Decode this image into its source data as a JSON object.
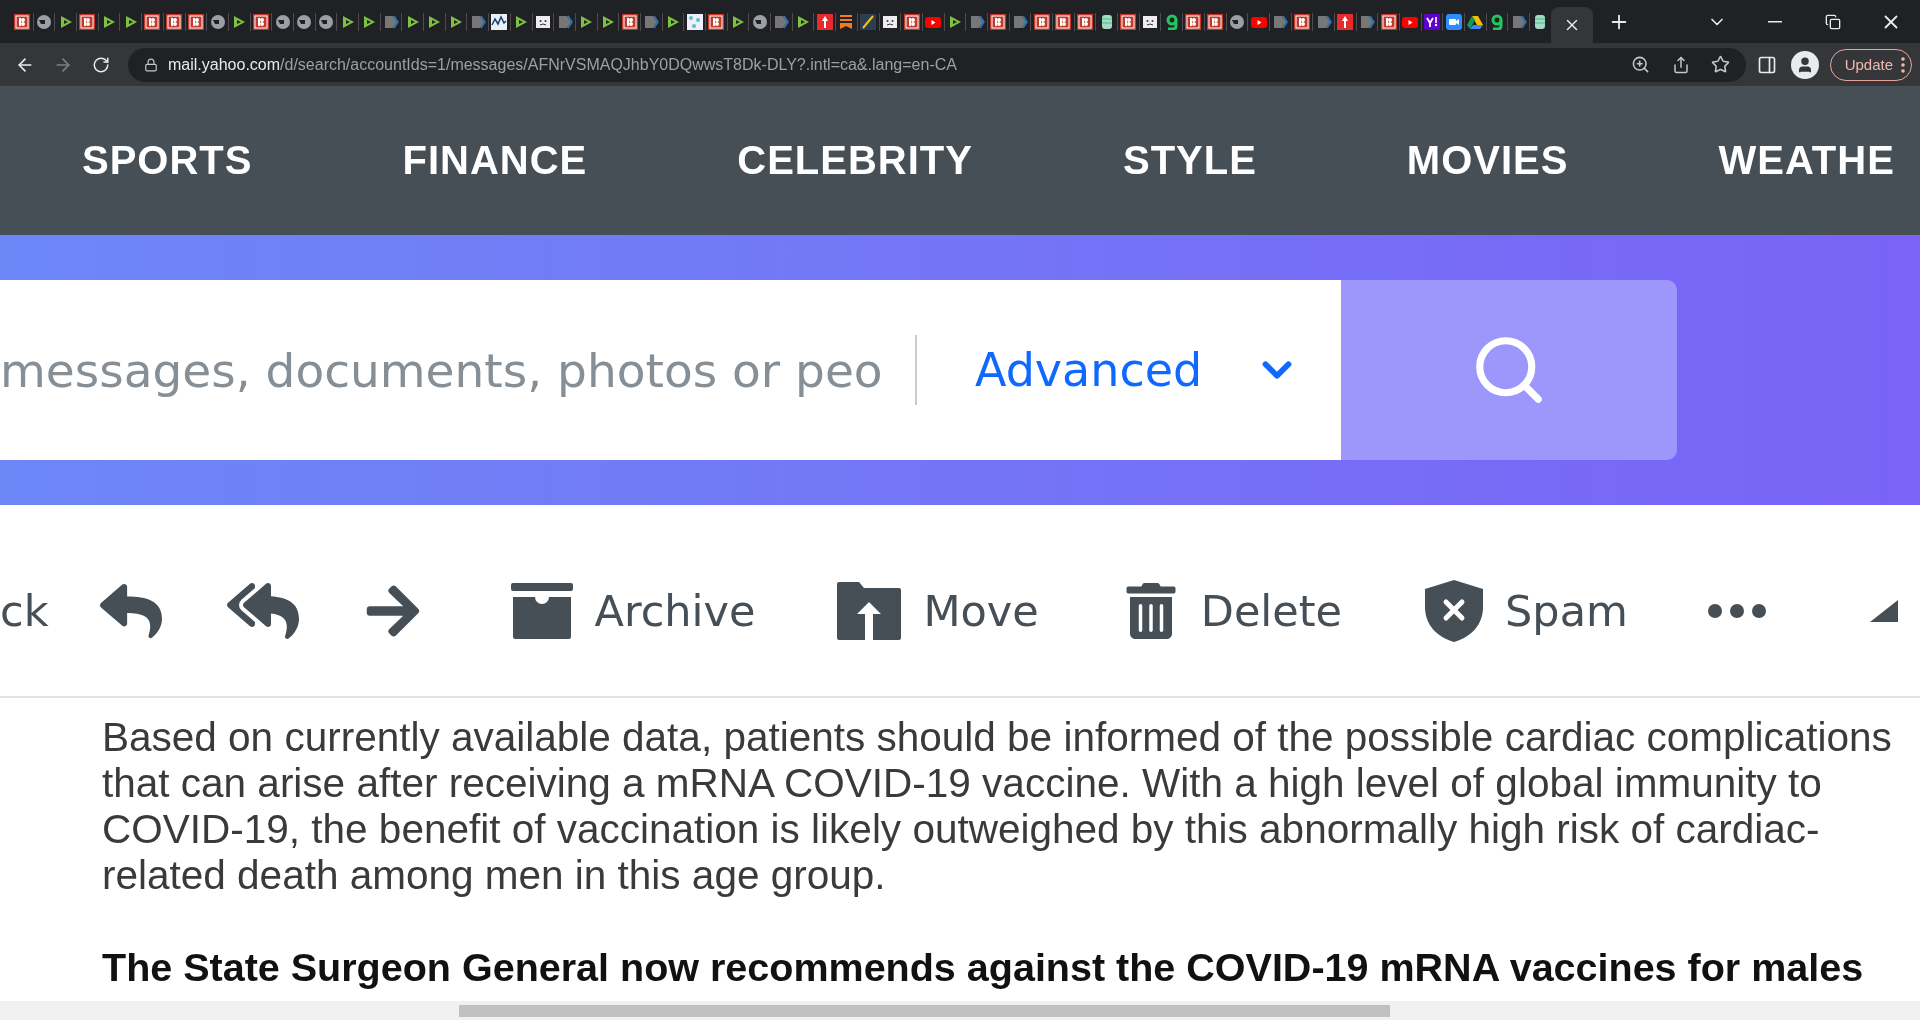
{
  "browser": {
    "tabs": [
      {
        "kind": "b",
        "selected": false
      },
      {
        "kind": "globe",
        "selected": false
      },
      {
        "kind": "play",
        "selected": false
      },
      {
        "kind": "b",
        "selected": false
      },
      {
        "kind": "play",
        "selected": false
      },
      {
        "kind": "play",
        "selected": false
      },
      {
        "kind": "b",
        "selected": false
      },
      {
        "kind": "b",
        "selected": false
      },
      {
        "kind": "b",
        "selected": false
      },
      {
        "kind": "globe",
        "selected": false
      },
      {
        "kind": "play",
        "selected": false
      },
      {
        "kind": "b",
        "selected": false
      },
      {
        "kind": "globe",
        "selected": false
      },
      {
        "kind": "globe",
        "selected": false
      },
      {
        "kind": "globe",
        "selected": false
      },
      {
        "kind": "play",
        "selected": false
      },
      {
        "kind": "play",
        "selected": false
      },
      {
        "kind": "arrow",
        "selected": false
      },
      {
        "kind": "play",
        "selected": false
      },
      {
        "kind": "play",
        "selected": false
      },
      {
        "kind": "play",
        "selected": false
      },
      {
        "kind": "arrow",
        "selected": false
      },
      {
        "kind": "chart",
        "selected": false
      },
      {
        "kind": "play",
        "selected": false
      },
      {
        "kind": "sad",
        "selected": false
      },
      {
        "kind": "arrow",
        "selected": false
      },
      {
        "kind": "play",
        "selected": false
      },
      {
        "kind": "play",
        "selected": false
      },
      {
        "kind": "b",
        "selected": false
      },
      {
        "kind": "arrow",
        "selected": false
      },
      {
        "kind": "play",
        "selected": false
      },
      {
        "kind": "dots",
        "selected": false
      },
      {
        "kind": "b",
        "selected": false
      },
      {
        "kind": "play",
        "selected": false
      },
      {
        "kind": "globe",
        "selected": false
      },
      {
        "kind": "arrow",
        "selected": false
      },
      {
        "kind": "play",
        "selected": false
      },
      {
        "kind": "flag",
        "selected": false
      },
      {
        "kind": "bookmark",
        "selected": false
      },
      {
        "kind": "slash",
        "selected": false
      },
      {
        "kind": "sad",
        "selected": false
      },
      {
        "kind": "b",
        "selected": false
      },
      {
        "kind": "youtube",
        "selected": false
      },
      {
        "kind": "play",
        "selected": false
      },
      {
        "kind": "arrow",
        "selected": false
      },
      {
        "kind": "b",
        "selected": false
      },
      {
        "kind": "arrow",
        "selected": false
      },
      {
        "kind": "b",
        "selected": false
      },
      {
        "kind": "b",
        "selected": false
      },
      {
        "kind": "b",
        "selected": false
      },
      {
        "kind": "jar",
        "selected": false
      },
      {
        "kind": "b",
        "selected": false
      },
      {
        "kind": "sad",
        "selected": false
      },
      {
        "kind": "g",
        "selected": false
      },
      {
        "kind": "b",
        "selected": false
      },
      {
        "kind": "b",
        "selected": false
      },
      {
        "kind": "globe",
        "selected": false
      },
      {
        "kind": "youtube",
        "selected": false
      },
      {
        "kind": "arrow",
        "selected": false
      },
      {
        "kind": "b",
        "selected": false
      },
      {
        "kind": "arrow",
        "selected": false
      },
      {
        "kind": "flag",
        "selected": false
      },
      {
        "kind": "arrow",
        "selected": false
      },
      {
        "kind": "b",
        "selected": false
      },
      {
        "kind": "youtube",
        "selected": false
      },
      {
        "kind": "yahoo",
        "selected": false
      },
      {
        "kind": "camera",
        "selected": false
      },
      {
        "kind": "drive",
        "selected": false
      },
      {
        "kind": "g",
        "selected": false
      },
      {
        "kind": "arrow",
        "selected": false
      },
      {
        "kind": "jar",
        "selected": false
      },
      {
        "selected": true
      }
    ],
    "address_bar": {
      "host": "mail.yahoo.com",
      "path": "/d/search/accountIds=1/messages/AFNrVSMAQJhbY0DQwwsT8Dk-DLY?.intl=ca&.lang=en-CA"
    },
    "update_button": {
      "label": "Update"
    }
  },
  "nav": {
    "items": [
      "SPORTS",
      "FINANCE",
      "CELEBRITY",
      "STYLE",
      "MOVIES",
      "WEATHE"
    ]
  },
  "search": {
    "placeholder": "messages, documents, photos or peo",
    "advanced_label": "Advanced"
  },
  "toolbar": {
    "items": [
      {
        "kind": "text",
        "label": "ck"
      },
      {
        "kind": "reply"
      },
      {
        "kind": "reply_all"
      },
      {
        "kind": "forward"
      },
      {
        "kind": "archive",
        "label": "Archive"
      },
      {
        "kind": "move",
        "label": "Move"
      },
      {
        "kind": "delete",
        "label": "Delete"
      },
      {
        "kind": "spam",
        "label": "Spam"
      },
      {
        "kind": "more"
      },
      {
        "kind": "up"
      }
    ]
  },
  "message": {
    "paragraphs": [
      {
        "text": "Based on currently available data, patients should be informed of the possible cardiac complications that can arise after receiving a mRNA COVID-19 vaccine. With a high level of global immunity to COVID-19, the benefit of vaccination is likely outweighed by this abnormally high risk of cardiac-related death among men in this age group.",
        "bold": false
      },
      {
        "text": "The State Surgeon General now recommends against the COVID-19 mRNA vaccines for males",
        "bold": true
      }
    ]
  }
}
